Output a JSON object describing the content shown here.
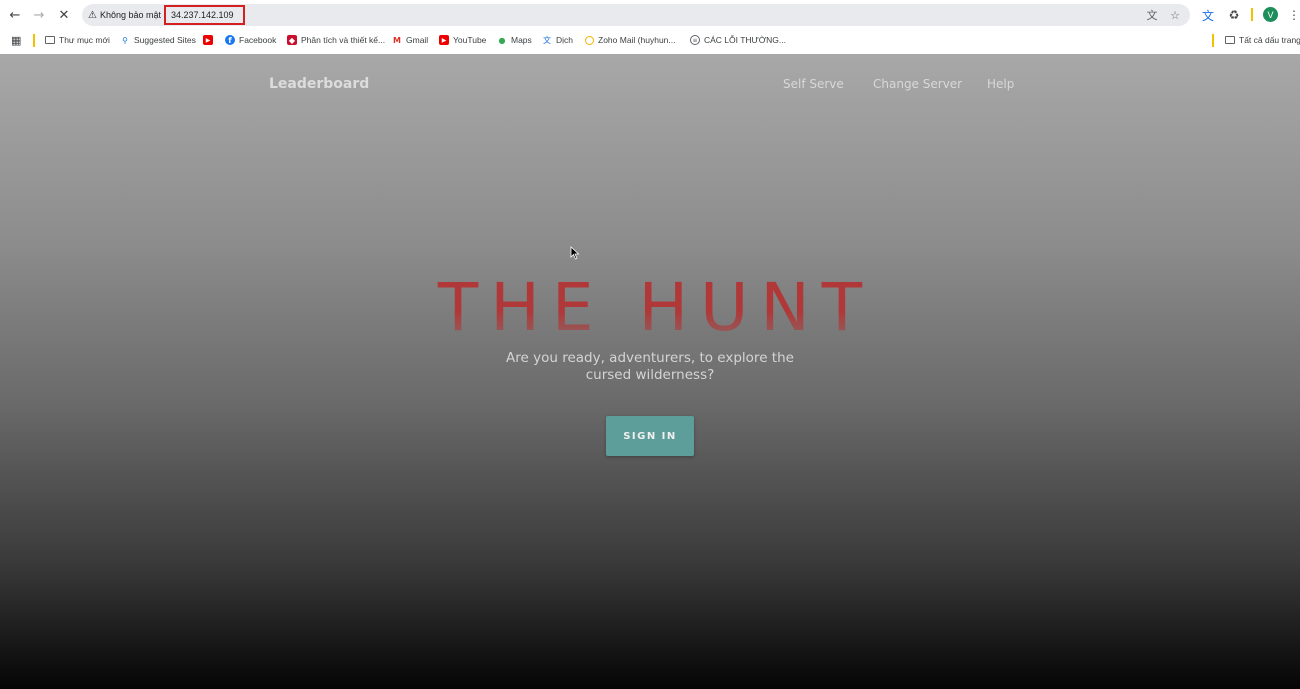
{
  "browser": {
    "security_label": "Không bảo mật",
    "url": "34.237.142.109",
    "profile_initial": "V"
  },
  "bookmarks": [
    {
      "label": "Thư mục mới",
      "icon": "folder-icon"
    },
    {
      "label": "Suggested Sites",
      "icon": "search-icon"
    },
    {
      "label": "",
      "icon": "youtube-icon"
    },
    {
      "label": "Facebook",
      "icon": "facebook-icon"
    },
    {
      "label": "Phân tích và thiết kế...",
      "icon": "shield-icon"
    },
    {
      "label": "Gmail",
      "icon": "gmail-icon"
    },
    {
      "label": "YouTube",
      "icon": "youtube-icon"
    },
    {
      "label": "Maps",
      "icon": "maps-icon"
    },
    {
      "label": "Dịch",
      "icon": "translate-icon"
    },
    {
      "label": "Zoho Mail (huyhun...",
      "icon": "zoho-icon"
    },
    {
      "label": "CÁC LỖI THƯỜNG...",
      "icon": "document-icon"
    }
  ],
  "all_bookmarks_label": "Tất cả dấu trang",
  "site": {
    "brand": "Leaderboard",
    "nav": [
      "Self Serve",
      "Change Server",
      "Help"
    ],
    "title": "THE HUNT",
    "subtitle": "Are you ready, adventurers, to explore the cursed wilderness?",
    "cta": "SIGN IN"
  },
  "colors": {
    "title": "#b03838",
    "button": "#5e9e9a",
    "url_highlight": "#d42020"
  }
}
